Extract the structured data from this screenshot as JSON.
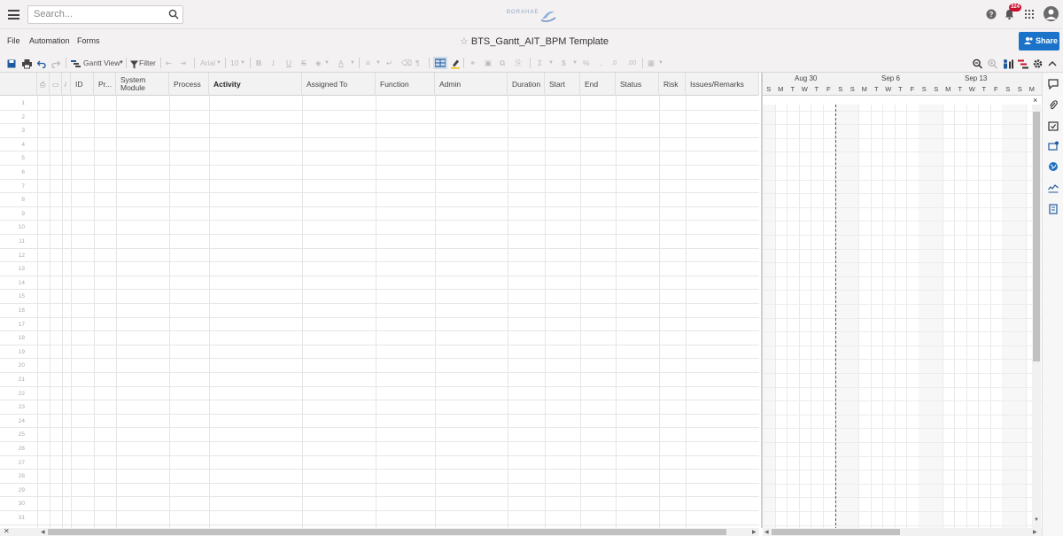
{
  "topbar": {
    "search_placeholder": "Search...",
    "logo_text": "BORAHAE",
    "notification_count": "324"
  },
  "menubar": {
    "items": [
      "File",
      "Automation",
      "Forms"
    ],
    "sheet_title": "BTS_Gantt_AIT_BPM Template",
    "share_label": "Share"
  },
  "toolbar": {
    "view_label": "Gantt View",
    "filter_label": "Filter",
    "font_name": "Arial",
    "font_size": "10",
    "sum_symbol": "Σ",
    "currency_symbol": "$",
    "percent_symbol": "%",
    "comma_symbol": ",",
    "decimal_dec": ".0",
    "decimal_inc": ".00"
  },
  "grid": {
    "columns": [
      "ID",
      "Pr...",
      "System Module",
      "Process",
      "Activity",
      "Assigned To",
      "Function",
      "Admin",
      "Duration",
      "Start",
      "End",
      "Status",
      "Risk",
      "Issues/Remarks"
    ],
    "row_numbers": [
      "1",
      "2",
      "3",
      "4",
      "5",
      "6",
      "7",
      "8",
      "9",
      "10",
      "11",
      "12",
      "13",
      "14",
      "15",
      "16",
      "17",
      "18",
      "19",
      "20",
      "21",
      "22",
      "23",
      "24",
      "25",
      "26",
      "27",
      "28",
      "29",
      "30",
      "31"
    ]
  },
  "gantt": {
    "weeks": [
      "Aug 30",
      "Sep 6",
      "Sep 13"
    ],
    "days": [
      "S",
      "M",
      "T",
      "W",
      "T",
      "F",
      "S",
      "S",
      "M",
      "T",
      "W",
      "T",
      "F",
      "S",
      "S",
      "M",
      "T",
      "W",
      "T",
      "F",
      "S",
      "S",
      "M"
    ]
  },
  "colors": {
    "accent": "#1a73c9",
    "badge": "#c8102e",
    "header_bg": "#f3f1f2"
  }
}
